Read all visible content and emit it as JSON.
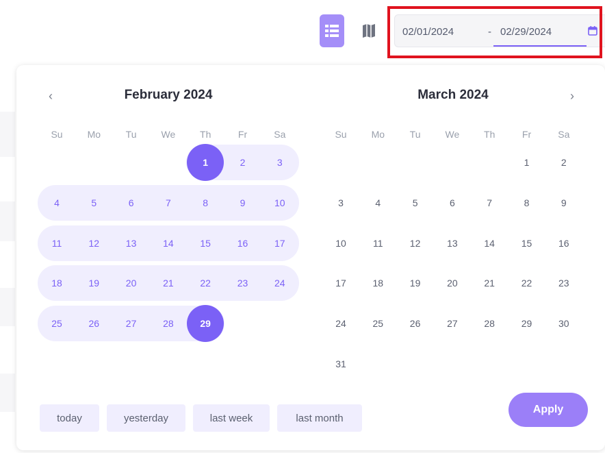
{
  "colors": {
    "accent": "#7b61f6",
    "range_fill": "#f0eefe",
    "highlight_box": "#e0131e"
  },
  "toolbar": {
    "list_view_icon": "list-icon",
    "map_view_icon": "map-icon"
  },
  "date_range": {
    "start": "02/01/2024",
    "separator": "-",
    "end": "02/29/2024",
    "icon": "calendar-icon"
  },
  "calendar": {
    "prev_label": "‹",
    "next_label": "›",
    "weekdays": [
      "Su",
      "Mo",
      "Tu",
      "We",
      "Th",
      "Fr",
      "Sa"
    ],
    "left": {
      "title": "February 2024",
      "weeks": [
        [
          "",
          "",
          "",
          "",
          "1",
          "2",
          "3"
        ],
        [
          "4",
          "5",
          "6",
          "7",
          "8",
          "9",
          "10"
        ],
        [
          "11",
          "12",
          "13",
          "14",
          "15",
          "16",
          "17"
        ],
        [
          "18",
          "19",
          "20",
          "21",
          "22",
          "23",
          "24"
        ],
        [
          "25",
          "26",
          "27",
          "28",
          "29",
          "",
          ""
        ]
      ]
    },
    "right": {
      "title": "March 2024",
      "weeks": [
        [
          "",
          "",
          "",
          "",
          "",
          "1",
          "2"
        ],
        [
          "3",
          "4",
          "5",
          "6",
          "7",
          "8",
          "9"
        ],
        [
          "10",
          "11",
          "12",
          "13",
          "14",
          "15",
          "16"
        ],
        [
          "17",
          "18",
          "19",
          "20",
          "21",
          "22",
          "23"
        ],
        [
          "24",
          "25",
          "26",
          "27",
          "28",
          "29",
          "30"
        ],
        [
          "31",
          "",
          "",
          "",
          "",
          "",
          ""
        ]
      ]
    },
    "selected_start": "1",
    "selected_end": "29"
  },
  "presets": [
    "today",
    "yesterday",
    "last week",
    "last month"
  ],
  "apply_label": "Apply"
}
